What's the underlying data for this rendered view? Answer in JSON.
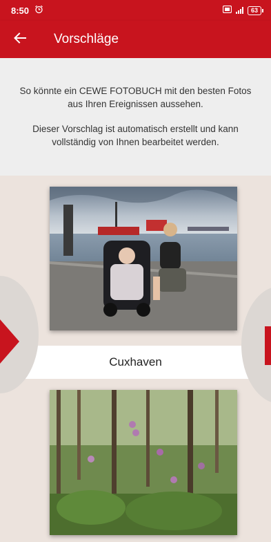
{
  "status_bar": {
    "time": "8:50",
    "battery": "63"
  },
  "app_bar": {
    "title": "Vorschläge"
  },
  "intro": {
    "paragraph1": "So könnte ein CEWE FOTOBUCH mit den besten Fotos aus Ihren Ereignissen aussehen.",
    "paragraph2": "Dieser Vorschlag ist automatisch erstellt und kann vollständig von Ihnen bearbeitet werden."
  },
  "suggestions": [
    {
      "caption": "Cuxhaven"
    }
  ],
  "colors": {
    "brand_red": "#c8141e",
    "background": "#ece3dd",
    "intro_bg": "#eeeeee"
  },
  "icons": {
    "back": "arrow-left-icon",
    "alarm": "alarm-icon",
    "next": "chevron-right-icon",
    "prev": "chevron-left-icon"
  }
}
